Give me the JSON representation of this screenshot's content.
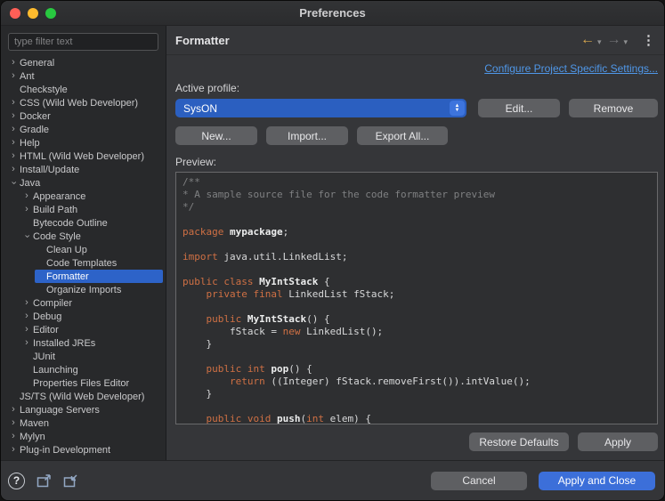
{
  "window": {
    "title": "Preferences"
  },
  "icons": {
    "back": "←",
    "forward": "→",
    "caret": "▾",
    "menu": "⋮",
    "help": "?",
    "stepper_up": "▲",
    "stepper_down": "▼"
  },
  "colors": {
    "selection_blue": "#2d63c8",
    "combo_blue": "#2b5fc0",
    "primary_button_blue": "#3c6fd9",
    "link_blue": "#4f97e8",
    "back_arrow_gold": "#dba94e",
    "keyword_orange": "#cf7044"
  },
  "sidebar": {
    "filter_placeholder": "type filter text",
    "tree": [
      {
        "label": "General",
        "level": 0,
        "state": "collapsed"
      },
      {
        "label": "Ant",
        "level": 0,
        "state": "collapsed"
      },
      {
        "label": "Checkstyle",
        "level": 0,
        "state": "none"
      },
      {
        "label": "CSS (Wild Web Developer)",
        "level": 0,
        "state": "collapsed"
      },
      {
        "label": "Docker",
        "level": 0,
        "state": "collapsed"
      },
      {
        "label": "Gradle",
        "level": 0,
        "state": "collapsed"
      },
      {
        "label": "Help",
        "level": 0,
        "state": "collapsed"
      },
      {
        "label": "HTML (Wild Web Developer)",
        "level": 0,
        "state": "collapsed"
      },
      {
        "label": "Install/Update",
        "level": 0,
        "state": "collapsed"
      },
      {
        "label": "Java",
        "level": 0,
        "state": "expanded"
      },
      {
        "label": "Appearance",
        "level": 1,
        "state": "collapsed"
      },
      {
        "label": "Build Path",
        "level": 1,
        "state": "collapsed"
      },
      {
        "label": "Bytecode Outline",
        "level": 1,
        "state": "none"
      },
      {
        "label": "Code Style",
        "level": 1,
        "state": "expanded"
      },
      {
        "label": "Clean Up",
        "level": 2,
        "state": "none"
      },
      {
        "label": "Code Templates",
        "level": 2,
        "state": "none"
      },
      {
        "label": "Formatter",
        "level": 2,
        "state": "none",
        "selected": true
      },
      {
        "label": "Organize Imports",
        "level": 2,
        "state": "none"
      },
      {
        "label": "Compiler",
        "level": 1,
        "state": "collapsed"
      },
      {
        "label": "Debug",
        "level": 1,
        "state": "collapsed"
      },
      {
        "label": "Editor",
        "level": 1,
        "state": "collapsed"
      },
      {
        "label": "Installed JREs",
        "level": 1,
        "state": "collapsed"
      },
      {
        "label": "JUnit",
        "level": 1,
        "state": "none"
      },
      {
        "label": "Launching",
        "level": 1,
        "state": "none"
      },
      {
        "label": "Properties Files Editor",
        "level": 1,
        "state": "none"
      },
      {
        "label": "JS/TS (Wild Web Developer)",
        "level": 0,
        "state": "none"
      },
      {
        "label": "Language Servers",
        "level": 0,
        "state": "collapsed"
      },
      {
        "label": "Maven",
        "level": 0,
        "state": "collapsed"
      },
      {
        "label": "Mylyn",
        "level": 0,
        "state": "collapsed"
      },
      {
        "label": "Plug-in Development",
        "level": 0,
        "state": "collapsed"
      }
    ]
  },
  "content": {
    "header": "Formatter",
    "link": "Configure Project Specific Settings...",
    "active_profile_label": "Active profile:",
    "profile": {
      "value": "SysON"
    },
    "buttons": {
      "edit": "Edit...",
      "remove": "Remove",
      "new": "New...",
      "import": "Import...",
      "export_all": "Export All...",
      "restore_defaults": "Restore Defaults",
      "apply": "Apply"
    },
    "preview_label": "Preview:",
    "preview": {
      "colors": {
        "comment": "#7f8082",
        "keyword": "#cf7044",
        "plain": "#d8d9da",
        "name": "#eceded"
      },
      "lines": [
        [
          {
            "c": "comment",
            "t": "/**"
          }
        ],
        [
          {
            "c": "comment",
            "t": "* A sample source file for the code formatter preview"
          }
        ],
        [
          {
            "c": "comment",
            "t": "*/"
          }
        ],
        [],
        [
          {
            "c": "keyword",
            "t": "package"
          },
          {
            "c": "plain",
            "t": " "
          },
          {
            "c": "name",
            "t": "mypackage"
          },
          {
            "c": "plain",
            "t": ";"
          }
        ],
        [],
        [
          {
            "c": "keyword",
            "t": "import"
          },
          {
            "c": "plain",
            "t": " java.util.LinkedList;"
          }
        ],
        [],
        [
          {
            "c": "keyword",
            "t": "public class"
          },
          {
            "c": "plain",
            "t": " "
          },
          {
            "c": "name",
            "t": "MyIntStack"
          },
          {
            "c": "plain",
            "t": " {"
          }
        ],
        [
          {
            "c": "plain",
            "t": "    "
          },
          {
            "c": "keyword",
            "t": "private final"
          },
          {
            "c": "plain",
            "t": " LinkedList fStack;"
          }
        ],
        [],
        [
          {
            "c": "plain",
            "t": "    "
          },
          {
            "c": "keyword",
            "t": "public"
          },
          {
            "c": "plain",
            "t": " "
          },
          {
            "c": "name",
            "t": "MyIntStack"
          },
          {
            "c": "plain",
            "t": "() {"
          }
        ],
        [
          {
            "c": "plain",
            "t": "        fStack = "
          },
          {
            "c": "keyword",
            "t": "new"
          },
          {
            "c": "plain",
            "t": " LinkedList();"
          }
        ],
        [
          {
            "c": "plain",
            "t": "    }"
          }
        ],
        [],
        [
          {
            "c": "plain",
            "t": "    "
          },
          {
            "c": "keyword",
            "t": "public int"
          },
          {
            "c": "plain",
            "t": " "
          },
          {
            "c": "name",
            "t": "pop"
          },
          {
            "c": "plain",
            "t": "() {"
          }
        ],
        [
          {
            "c": "plain",
            "t": "        "
          },
          {
            "c": "keyword",
            "t": "return"
          },
          {
            "c": "plain",
            "t": " ((Integer) fStack.removeFirst()).intValue();"
          }
        ],
        [
          {
            "c": "plain",
            "t": "    }"
          }
        ],
        [],
        [
          {
            "c": "plain",
            "t": "    "
          },
          {
            "c": "keyword",
            "t": "public void"
          },
          {
            "c": "plain",
            "t": " "
          },
          {
            "c": "name",
            "t": "push"
          },
          {
            "c": "plain",
            "t": "("
          },
          {
            "c": "keyword",
            "t": "int"
          },
          {
            "c": "plain",
            "t": " elem) {"
          }
        ]
      ]
    }
  },
  "footer": {
    "cancel": "Cancel",
    "apply_and_close": "Apply and Close"
  }
}
